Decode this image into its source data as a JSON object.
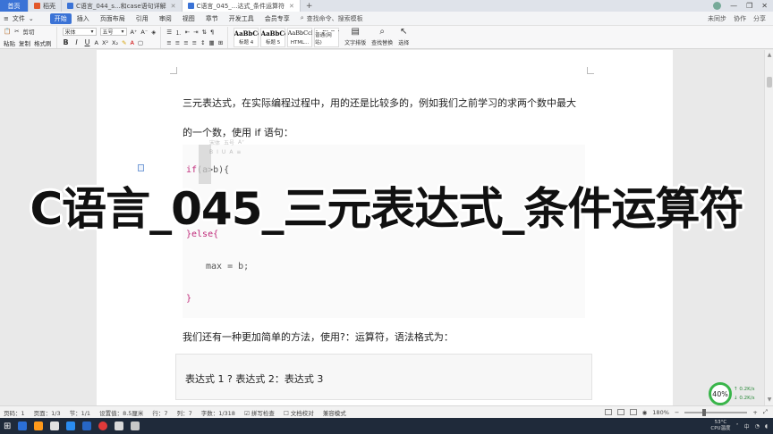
{
  "tabs": {
    "home": "首页",
    "items": [
      {
        "label": "稻壳",
        "color": "#e2582b"
      },
      {
        "label": "C语言_044_s...和case语句详解",
        "color": "#3b73d6"
      },
      {
        "label": "C语言_045_...达式_条件运算符",
        "color": "#3b73d6"
      }
    ],
    "add": "+"
  },
  "window": {
    "min": "—",
    "max": "❐",
    "close": "✕"
  },
  "menu": {
    "file": "文件",
    "items": [
      "开始",
      "插入",
      "页面布局",
      "引用",
      "审阅",
      "视图",
      "章节",
      "开发工具",
      "会员专享"
    ],
    "search": "查找命令、搜索模板",
    "right": [
      "未同步",
      "协作",
      "分享"
    ]
  },
  "ribbon": {
    "paste": "粘贴",
    "cut": "剪切",
    "copy": "复制",
    "format_painter": "格式刷",
    "font_name": "宋体",
    "font_size": "五号",
    "styles": [
      {
        "sample": "AaBbCcDc",
        "name": "标题 4"
      },
      {
        "sample": "AaBbCc",
        "name": "标题 5"
      },
      {
        "sample": "AaBbCcDc",
        "name": "HTML..."
      },
      {
        "sample": "AaBbCcD",
        "name": "普通(网站)"
      }
    ],
    "text_layout": "文字排版",
    "find_replace": "查找替换",
    "select": "选择"
  },
  "document": {
    "line1": "三元表达式，在实际编程过程中，用的还是比较多的，例如我们之前学习的求两个数中最大",
    "line2": "的一个数，使用  if  语句：",
    "code": {
      "if_kw": "if",
      "if_rest": "(a>b){",
      "else_kw": "}else{",
      "assign": "max = b;",
      "close": "}"
    },
    "line3": "我们还有一种更加简单的方法，使用?：运算符，语法格式为：",
    "formula": "表达式 1 ? 表达式 2：表达式 3"
  },
  "mini_toolbar": {
    "font": "宋体",
    "size": "五号"
  },
  "overlay_title": "C语言_045_三元表达式_条件运算符",
  "speed": {
    "percent": "40%",
    "up": "0.2K/s",
    "down": "0.2K/s"
  },
  "status": {
    "page": "页码：1",
    "pages": "页面：1/3",
    "section": "节：1/1",
    "position": "设置值：8.5厘米",
    "row": "行：7",
    "col": "列：7",
    "words": "字数：1/318",
    "spell": "拼写检查",
    "proof": "文档校对",
    "compat": "兼容模式",
    "zoom": "180%"
  },
  "taskbar": {
    "start": "⊞",
    "apps_colors": [
      "#2b6fd6",
      "#ff9a1a",
      "#e0e0e0",
      "#2a8cf0",
      "#2766c5",
      "#e03a3a",
      "#d9d9d9",
      "#c8c8c8"
    ],
    "temp": "53°C",
    "cpu": "CPU温度",
    "ime": "中"
  }
}
